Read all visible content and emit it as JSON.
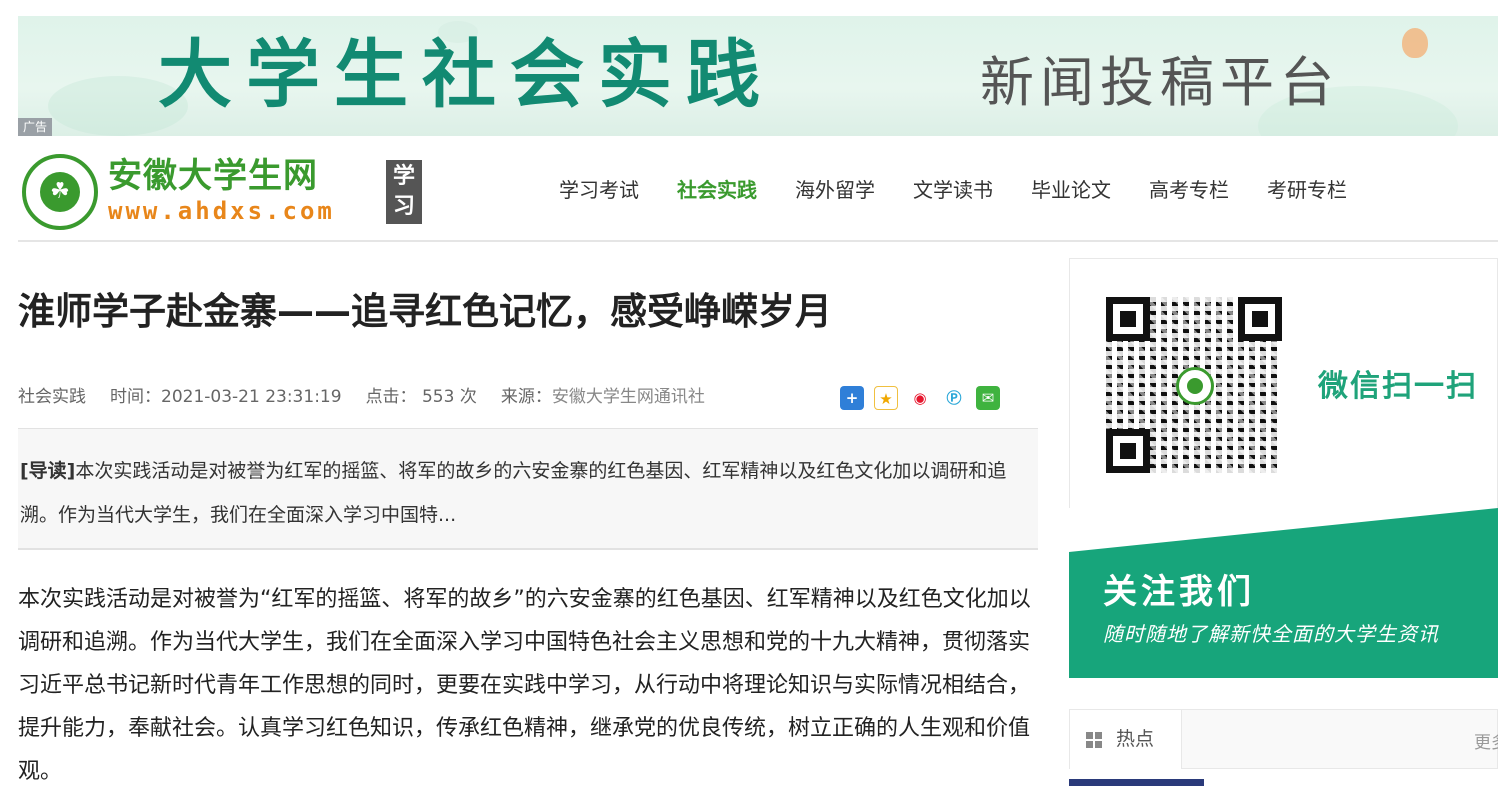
{
  "banner": {
    "main_text": "大学生社会实践",
    "sub_text": "新闻投稿平台",
    "ad_tag": "广告"
  },
  "header": {
    "logo_cn": "安徽大学生网",
    "logo_url": "www.ahdxs.com",
    "logo_badge": "学习",
    "nav": [
      {
        "label": "学习考试",
        "active": false
      },
      {
        "label": "社会实践",
        "active": true
      },
      {
        "label": "海外留学",
        "active": false
      },
      {
        "label": "文学读书",
        "active": false
      },
      {
        "label": "毕业论文",
        "active": false
      },
      {
        "label": "高考专栏",
        "active": false
      },
      {
        "label": "考研专栏",
        "active": false
      }
    ],
    "accent_color": "#3a9a2e"
  },
  "article": {
    "title": "淮师学子赴金寨——追寻红色记忆，感受峥嵘岁月",
    "category": "社会实践",
    "time": "时间：2021-03-21 23:31:19",
    "clicks": "点击： 553 次",
    "source_label": "来源：",
    "source": "安徽大学生网通讯社",
    "share_icons": [
      "plus-share-icon",
      "qzone-icon",
      "weibo-icon",
      "pinterest-icon",
      "wechat-icon"
    ],
    "lead_label": "[导读]",
    "lead_text": "本次实践活动是对被誉为红军的摇篮、将军的故乡的六安金寨的红色基因、红军精神以及红色文化加以调研和追溯。作为当代大学生，我们在全面深入学习中国特...",
    "body": "本次实践活动是对被誉为“红军的摇篮、将军的故乡”的六安金寨的红色基因、红军精神以及红色文化加以调研和追溯。作为当代大学生，我们在全面深入学习中国特色社会主义思想和党的十九大精神，贯彻落实习近平总书记新时代青年工作思想的同时，更要在实践中学习，从行动中将理论知识与实际情况相结合，提升能力，奉献社会。认真学习红色知识，传承红色精神，继承党的优良传统，树立正确的人生观和价值观。"
  },
  "sidebar": {
    "wechat_scan": "微信扫一扫",
    "follow_title": "关注我们",
    "follow_sub": "随时随地了解新快全面的大学生资讯",
    "hot_label": "热点",
    "more_label": "更多",
    "follow_color": "#17a57b"
  }
}
